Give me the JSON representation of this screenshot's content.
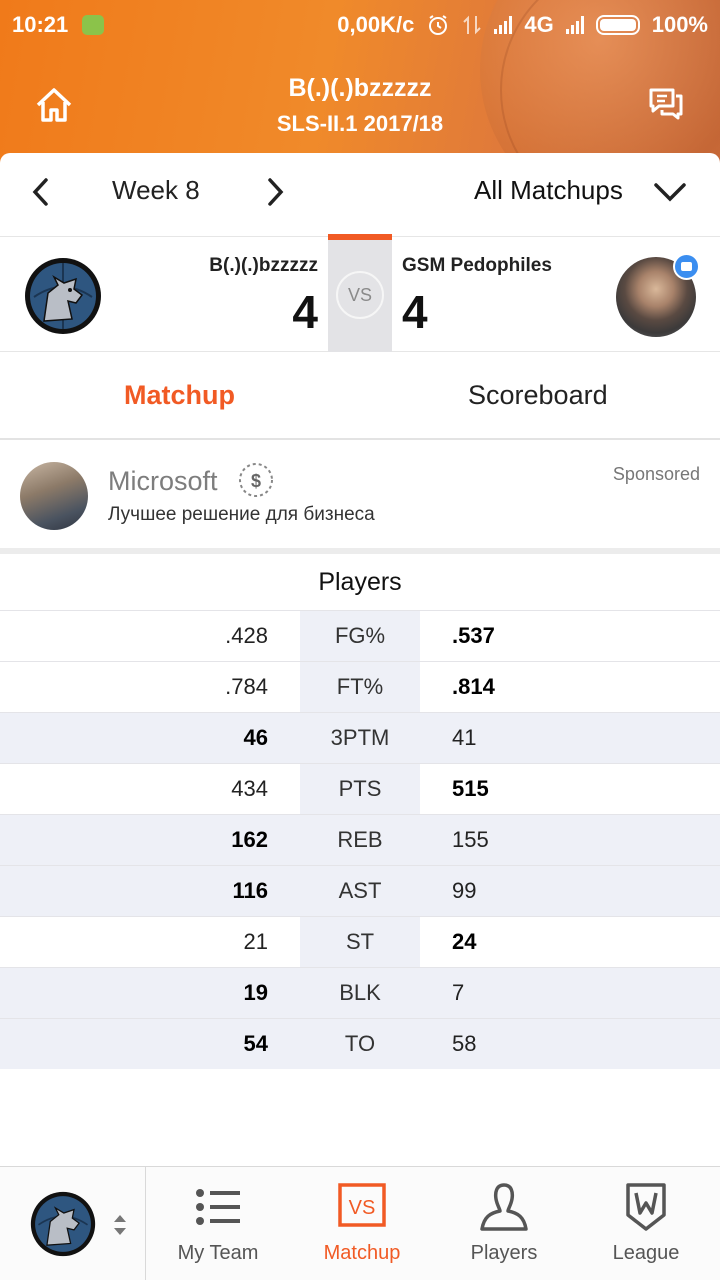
{
  "status_bar": {
    "time": "10:21",
    "speed": "0,00K/c",
    "network": "4G",
    "battery": "100%"
  },
  "header": {
    "title": "B(.)(.)bzzzzz",
    "subtitle": "SLS-II.1 2017/18"
  },
  "week_bar": {
    "week_label": "Week 8",
    "filter_label": "All Matchups"
  },
  "matchup": {
    "team_a": {
      "name": "B(.)(.)bzzzzz",
      "score": "4"
    },
    "vs": "VS",
    "team_b": {
      "name": "GSM Pedophiles",
      "score": "4"
    }
  },
  "tabs": {
    "matchup": "Matchup",
    "scoreboard": "Scoreboard"
  },
  "ad": {
    "title": "Microsoft",
    "description": "Лучшее решение для бизнеса",
    "sponsored": "Sponsored"
  },
  "stats": {
    "heading": "Players",
    "rows": [
      {
        "left": ".428",
        "cat": "FG%",
        "right": ".537",
        "winner": "right"
      },
      {
        "left": ".784",
        "cat": "FT%",
        "right": ".814",
        "winner": "right"
      },
      {
        "left": "46",
        "cat": "3PTM",
        "right": "41",
        "winner": "left"
      },
      {
        "left": "434",
        "cat": "PTS",
        "right": "515",
        "winner": "right"
      },
      {
        "left": "162",
        "cat": "REB",
        "right": "155",
        "winner": "left"
      },
      {
        "left": "116",
        "cat": "AST",
        "right": "99",
        "winner": "left"
      },
      {
        "left": "21",
        "cat": "ST",
        "right": "24",
        "winner": "right"
      },
      {
        "left": "19",
        "cat": "BLK",
        "right": "7",
        "winner": "left"
      },
      {
        "left": "54",
        "cat": "TO",
        "right": "58",
        "winner": "left"
      }
    ]
  },
  "bottom_nav": {
    "my_team": "My Team",
    "matchup": "Matchup",
    "matchup_icon_text": "VS",
    "players": "Players",
    "league": "League"
  },
  "colors": {
    "accent": "#f15a24",
    "header_orange": "#f08a2a",
    "highlight_row": "#eef0f7",
    "badge_blue": "#3b8ef0"
  }
}
